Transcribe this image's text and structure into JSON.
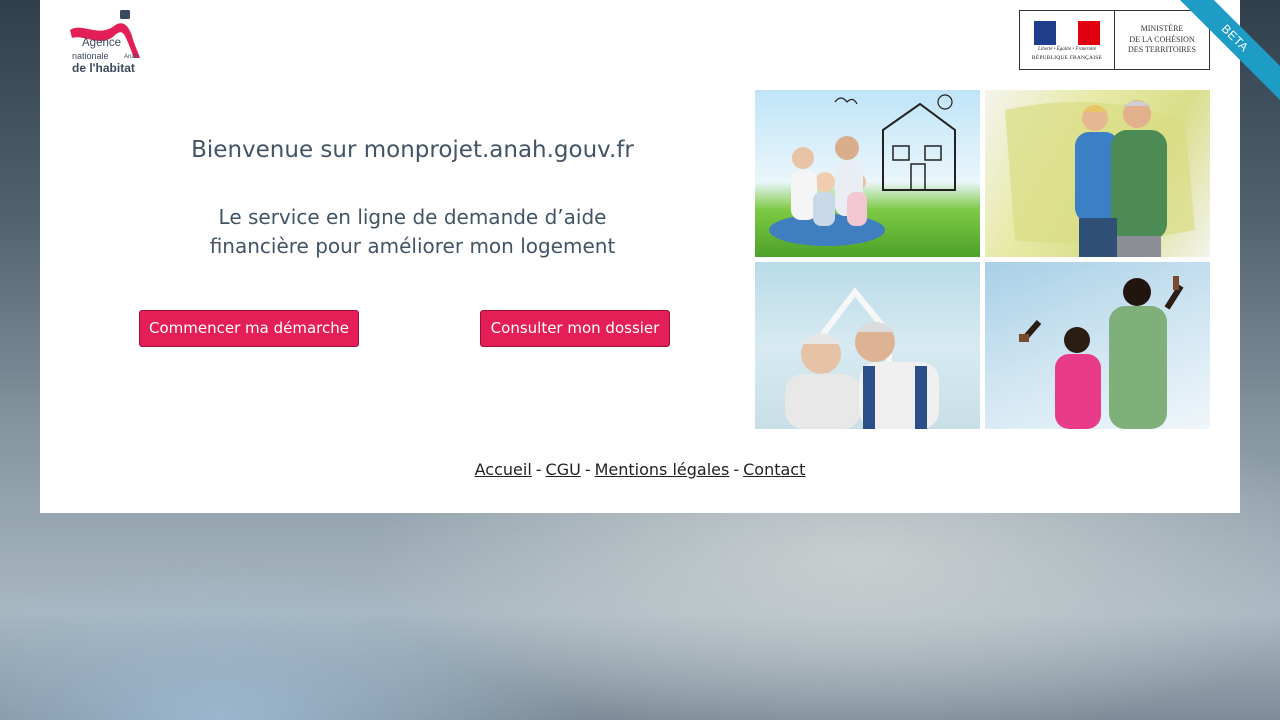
{
  "logo": {
    "line1": "Agence",
    "line2": "nationale",
    "line3": "de l'habitat",
    "short": "Anah",
    "brand_color": "#e41f57",
    "accent_color": "#3c4a5f"
  },
  "ministry": {
    "motto": "Liberté • Égalité • Fraternité",
    "republic": "RÉPUBLIQUE FRANÇAISE",
    "line1": "MINISTÈRE",
    "line2": "DE LA COHÉSION",
    "line3": "DES TERRITOIRES",
    "flag_colors": [
      "#1f3d8a",
      "#ffffff",
      "#e1000f"
    ]
  },
  "ribbon": {
    "label": "BETA",
    "color": "#1d9cc6"
  },
  "main": {
    "welcome": "Bienvenue sur monprojet.anah.gouv.fr",
    "subtitle_line1": "Le service en ligne de demande d’aide",
    "subtitle_line2": "financière pour améliorer mon logement"
  },
  "buttons": {
    "start": "Commencer ma démarche",
    "consult": "Consulter mon dossier",
    "color": "#e41f57"
  },
  "footer": {
    "links": [
      "Accueil",
      "CGU",
      "Mentions légales",
      "Contact"
    ],
    "separator": "-"
  }
}
